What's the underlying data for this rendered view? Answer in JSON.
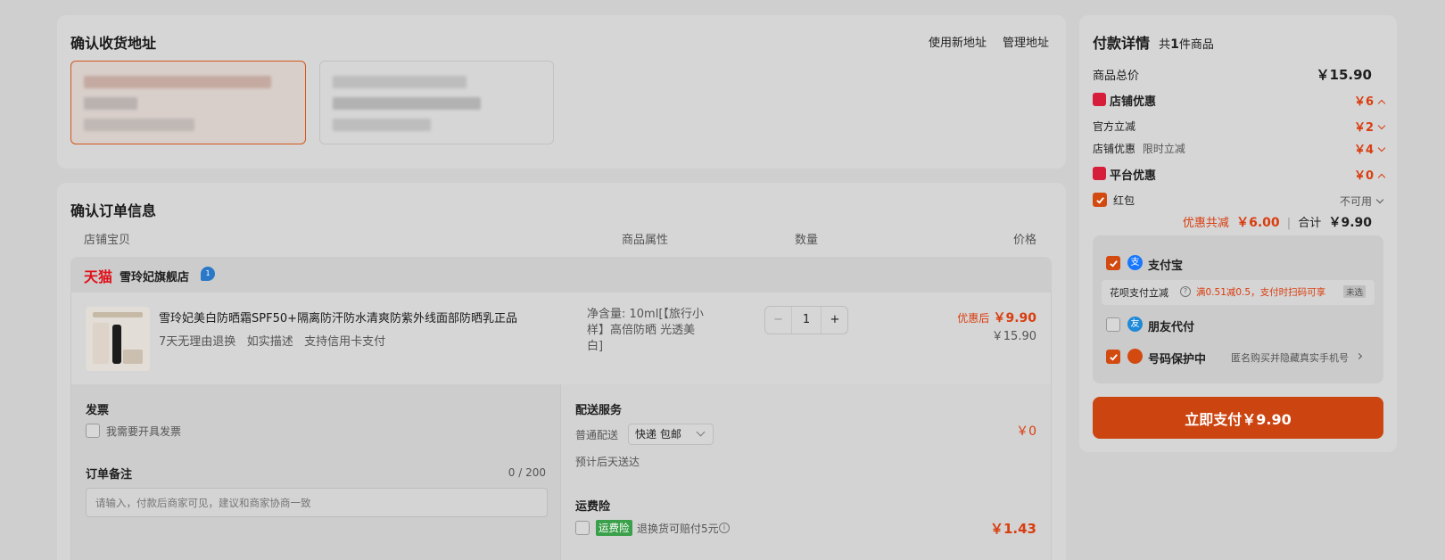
{
  "address": {
    "title": "确认收货地址",
    "new_address": "使用新地址",
    "manage_address": "管理地址"
  },
  "order": {
    "title": "确认订单信息",
    "columns": [
      "店铺宝贝",
      "商品属性",
      "数量",
      "价格"
    ],
    "shop": {
      "platform": "天猫",
      "name": "雪玲妃旗舰店",
      "badge": "1"
    },
    "item": {
      "name": "雪玲妃美白防晒霜SPF50+隔离防汗防水清爽防紫外线面部防晒乳正品",
      "services": [
        "7天无理由退换",
        "如实描述",
        "支持信用卡支付"
      ],
      "attr_line1": "净含量: 10ml[【旅行小",
      "attr_line2": "样】高倍防晒 光透美",
      "attr_line3": "白]",
      "qty": "1",
      "qty_minus": "−",
      "qty_plus": "+",
      "discount_label": "优惠后",
      "discount_price": "￥9.90",
      "orig_price": "￥15.90"
    },
    "invoice": {
      "title": "发票",
      "option": "我需要开具发票"
    },
    "remark": {
      "title": "订单备注",
      "count": "0 / 200",
      "placeholder": "请输入，付款后商家可见，建议和商家协商一致"
    },
    "delivery": {
      "title": "配送服务",
      "mode": "普通配送",
      "select": "快递 包邮",
      "eta": "预计后天送达",
      "price": "￥0"
    },
    "freight": {
      "title": "运费险",
      "tag": "运费险",
      "desc": "退换货可赔付5元",
      "price": "￥1.43"
    }
  },
  "payment": {
    "title": "付款详情",
    "count_prefix": "共",
    "count": "1",
    "count_suffix": "件商品",
    "total_label": "商品总价",
    "total_value": "￥15.90",
    "shop_discount_label": "店铺优惠",
    "shop_discount_value": "￥6",
    "official_label": "官方立减",
    "official_value": "￥2",
    "store_label": "店铺优惠",
    "store_sub": "限时立减",
    "store_value": "￥4",
    "platform_label": "平台优惠",
    "platform_value": "￥0",
    "hongbao_label": "红包",
    "hongbao_status": "不可用",
    "saving_label": "优惠共减",
    "saving_value": "￥6.00",
    "sum_label": "合计",
    "sum_value": "￥9.90",
    "methods": {
      "alipay": "支付宝",
      "huabei_label": "花呗支付立减",
      "huabei_promo": "满0.51减0.5，支付时扫码可享",
      "huabei_tag": "未选",
      "friend": "朋友代付",
      "protect": "号码保护中",
      "protect_desc": "匿名购买并隐藏真实手机号"
    },
    "pay_button": "立即支付￥9.90"
  },
  "colors": {
    "accent": "#d24a10",
    "pay_button": "#cc4410",
    "price_red": "#d93d0f",
    "alipay_blue": "#1677ff"
  }
}
